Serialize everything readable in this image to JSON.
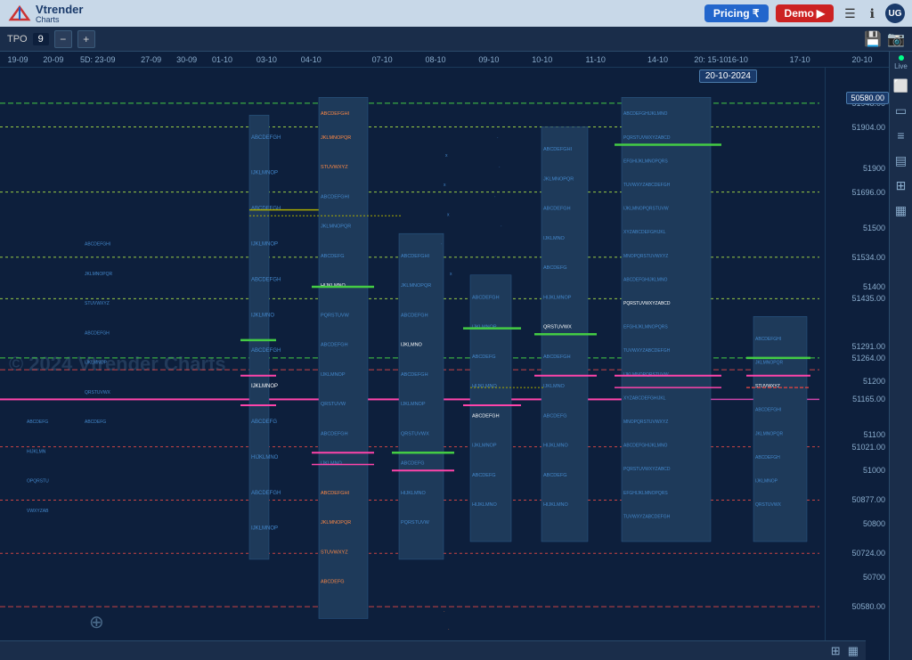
{
  "header": {
    "logo_text": "Vtrender",
    "logo_sub": "Charts",
    "pricing_label": "Pricing ₹",
    "demo_label": "Demo",
    "user_initials": "UG"
  },
  "toolbar": {
    "tpo_label": "TPO",
    "tpo_value": "9",
    "minus_label": "−",
    "plus_label": "+",
    "live_label": "Live"
  },
  "chart": {
    "date_tooltip": "20-10-2024",
    "watermark": "© 2024 Vtrender Charts",
    "price_bottom": "50580.00",
    "time_labels": [
      "19-09",
      "20-09",
      "5D: 23-09",
      "27-09",
      "30-09",
      "01-10",
      "03-10",
      "04-10",
      "07-10",
      "08-10",
      "09-10",
      "10-10",
      "11-10",
      "14-10",
      "20: 15-10",
      "16-10",
      "17-10",
      "20-10"
    ],
    "price_levels": [
      {
        "label": "51948.00",
        "pct": 6,
        "color": "#44cc44",
        "dash": "dashed"
      },
      {
        "label": "51904.00",
        "pct": 10,
        "color": "#88cc44",
        "dash": "dotted"
      },
      {
        "label": "51696.00",
        "pct": 20,
        "color": "#88cc44",
        "dash": "dotted"
      },
      {
        "label": "51534.00",
        "pct": 32,
        "color": "#88cc44",
        "dash": "dotted"
      },
      {
        "label": "51435.00",
        "pct": 39,
        "color": "#88cc44",
        "dash": "dotted"
      },
      {
        "label": "51291.00",
        "pct": 49,
        "color": "#44cc44",
        "dash": "dashed"
      },
      {
        "label": "51264.00",
        "pct": 51,
        "color": "#cc4444",
        "dash": "dashed"
      },
      {
        "label": "51165.00",
        "pct": 56,
        "color": "#cc88aa",
        "dash": "solid"
      },
      {
        "label": "51021.00",
        "pct": 64,
        "color": "#cc4444",
        "dash": "dotted"
      },
      {
        "label": "50877.00",
        "pct": 73,
        "color": "#cc4444",
        "dash": "dotted"
      },
      {
        "label": "50724.00",
        "pct": 82,
        "color": "#cc4444",
        "dash": "dotted"
      },
      {
        "label": "50580.00",
        "pct": 91,
        "color": "#cc4444",
        "dash": "dashed"
      }
    ]
  },
  "sidebar_icons": [
    "⊞",
    "▭",
    "≡",
    "▤",
    "⊞",
    "▦"
  ],
  "bottom_icons": [
    "⊞",
    "▦"
  ]
}
